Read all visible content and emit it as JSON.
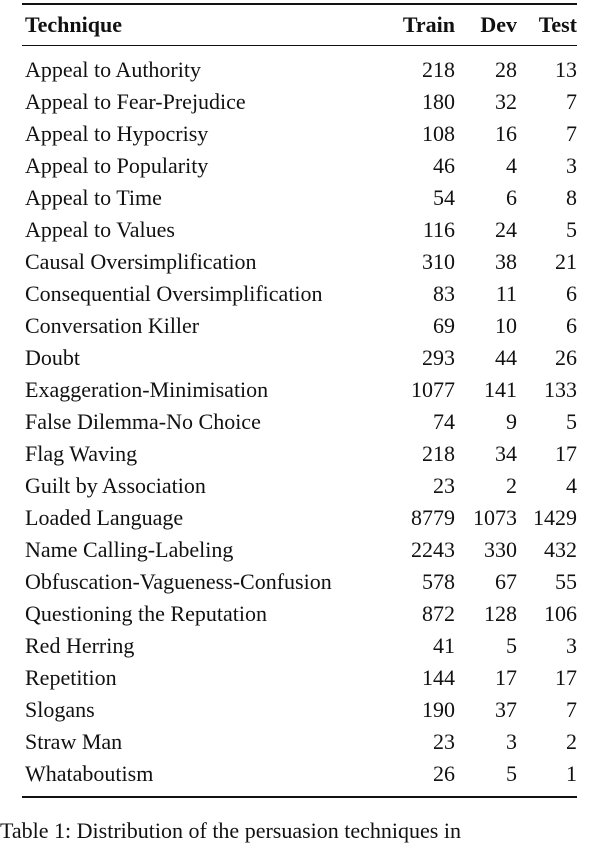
{
  "table": {
    "headers": [
      "Technique",
      "Train",
      "Dev",
      "Test"
    ],
    "rows": [
      [
        "Appeal to Authority",
        "218",
        "28",
        "13"
      ],
      [
        "Appeal to Fear-Prejudice",
        "180",
        "32",
        "7"
      ],
      [
        "Appeal to Hypocrisy",
        "108",
        "16",
        "7"
      ],
      [
        "Appeal to Popularity",
        "46",
        "4",
        "3"
      ],
      [
        "Appeal to Time",
        "54",
        "6",
        "8"
      ],
      [
        "Appeal to Values",
        "116",
        "24",
        "5"
      ],
      [
        "Causal Oversimplification",
        "310",
        "38",
        "21"
      ],
      [
        "Consequential Oversimplification",
        "83",
        "11",
        "6"
      ],
      [
        "Conversation Killer",
        "69",
        "10",
        "6"
      ],
      [
        "Doubt",
        "293",
        "44",
        "26"
      ],
      [
        "Exaggeration-Minimisation",
        "1077",
        "141",
        "133"
      ],
      [
        "False Dilemma-No Choice",
        "74",
        "9",
        "5"
      ],
      [
        "Flag Waving",
        "218",
        "34",
        "17"
      ],
      [
        "Guilt by Association",
        "23",
        "2",
        "4"
      ],
      [
        "Loaded Language",
        "8779",
        "1073",
        "1429"
      ],
      [
        "Name Calling-Labeling",
        "2243",
        "330",
        "432"
      ],
      [
        "Obfuscation-Vagueness-Confusion",
        "578",
        "67",
        "55"
      ],
      [
        "Questioning the Reputation",
        "872",
        "128",
        "106"
      ],
      [
        "Red Herring",
        "41",
        "5",
        "3"
      ],
      [
        "Repetition",
        "144",
        "17",
        "17"
      ],
      [
        "Slogans",
        "190",
        "37",
        "7"
      ],
      [
        "Straw Man",
        "23",
        "3",
        "2"
      ],
      [
        "Whataboutism",
        "26",
        "5",
        "1"
      ]
    ]
  },
  "caption": "Table 1: Distribution of the persuasion techniques in"
}
